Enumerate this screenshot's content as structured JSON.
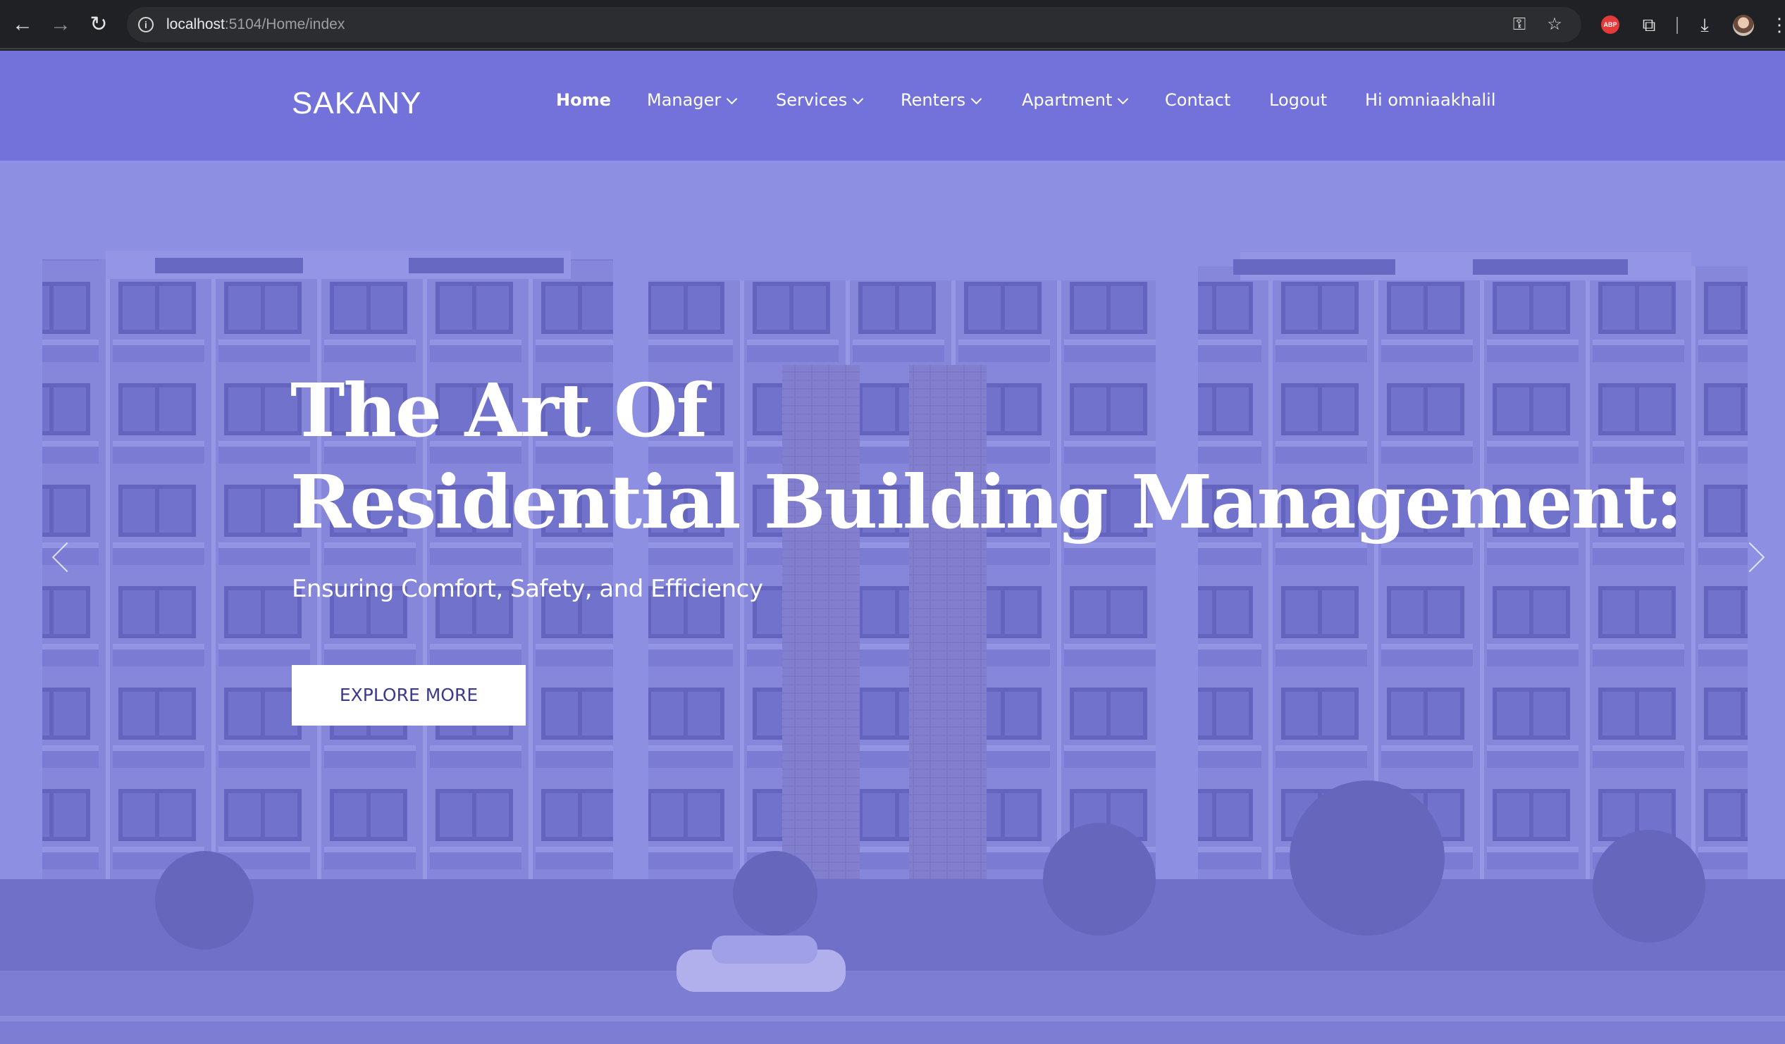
{
  "browser": {
    "url_host": "localhost",
    "url_rest": ":5104/Home/index",
    "extension_badge": "ABP"
  },
  "site": {
    "brand": "SAKANY",
    "nav": [
      {
        "label": "Home",
        "active": true,
        "dropdown": false
      },
      {
        "label": "Manager",
        "active": false,
        "dropdown": true
      },
      {
        "label": "Services",
        "active": false,
        "dropdown": true
      },
      {
        "label": "Renters",
        "active": false,
        "dropdown": true
      },
      {
        "label": "Apartment",
        "active": false,
        "dropdown": true
      },
      {
        "label": "Contact",
        "active": false,
        "dropdown": false
      },
      {
        "label": "Logout",
        "active": false,
        "dropdown": false
      },
      {
        "label": "Hi omniaakhalil",
        "active": false,
        "dropdown": false
      }
    ]
  },
  "hero": {
    "title_line1": "The Art Of",
    "title_line2": "Residential Building Management:",
    "subtitle": "Ensuring Comfort, Safety, and Efficiency",
    "cta_label": "EXPLORE MORE"
  },
  "icons": {
    "back": "arrow-left-icon",
    "forward": "arrow-right-icon",
    "reload": "reload-icon",
    "site_info": "info-icon",
    "password": "key-icon",
    "bookmark": "star-icon",
    "extensions": "puzzle-icon",
    "downloads": "download-icon",
    "menu": "kebab-icon",
    "prev_slide": "chevron-left-icon",
    "next_slide": "chevron-right-icon"
  },
  "colors": {
    "header_bg": "#7272da",
    "hero_tint": "#7876e6",
    "cta_text": "#3c3a8e"
  }
}
